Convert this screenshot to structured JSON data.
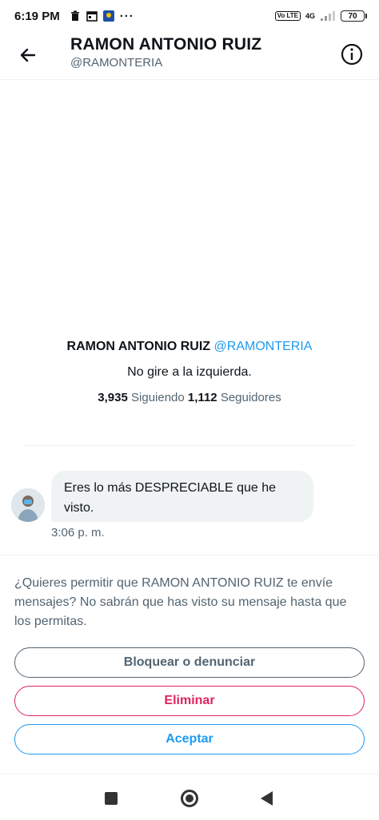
{
  "status_bar": {
    "time": "6:19 PM",
    "dots": "···",
    "network": "4G",
    "volte": "Vo LTE",
    "battery": "70"
  },
  "header": {
    "name": "RAMON ANTONIO RUIZ",
    "handle": "@RAMONTERIA"
  },
  "profile": {
    "name": "RAMON ANTONIO RUIZ",
    "handle": "@RAMONTERIA",
    "bio": "No gire a la izquierda.",
    "following_count": "3,935",
    "following_label": "Siguiendo",
    "followers_count": "1,112",
    "followers_label": "Seguidores"
  },
  "message": {
    "text": "Eres lo más DESPRECIABLE que he visto.",
    "time": "3:06 p. m."
  },
  "request": {
    "prompt": "¿Quieres permitir que RAMON ANTONIO RUIZ te envíe mensajes? No sabrán que has visto su mensaje hasta que los permitas.",
    "block_label": "Bloquear o denunciar",
    "delete_label": "Eliminar",
    "accept_label": "Aceptar"
  },
  "colors": {
    "accent": "#1d9bf0",
    "danger": "#e0245e",
    "muted": "#536471"
  }
}
